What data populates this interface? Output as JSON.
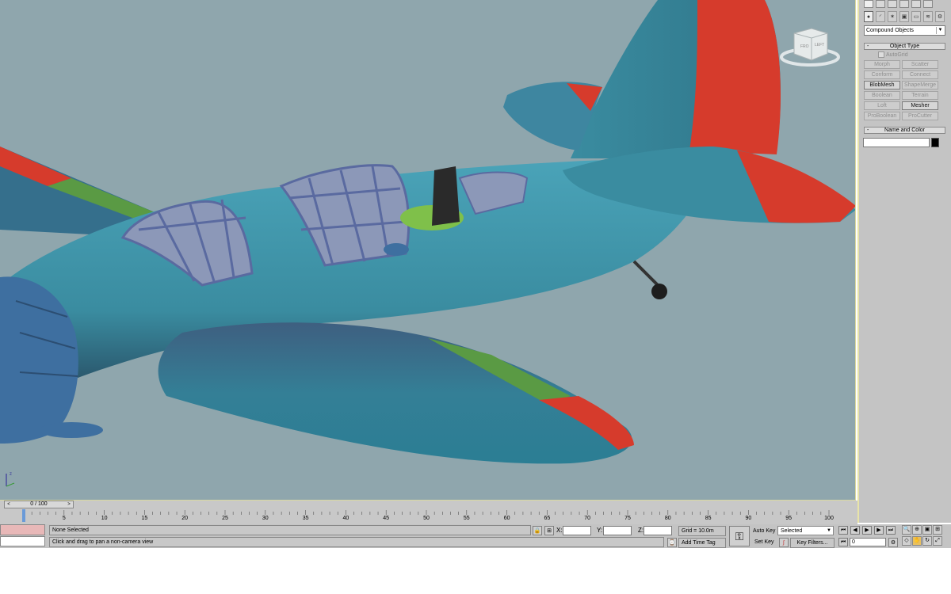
{
  "command_panel": {
    "category_dropdown": "Compound Objects",
    "object_type_rollout": "Object Type",
    "autogrid_label": "AutoGrid",
    "buttons": [
      {
        "label": "Morph",
        "enabled": false
      },
      {
        "label": "Scatter",
        "enabled": false
      },
      {
        "label": "Conform",
        "enabled": false
      },
      {
        "label": "Connect",
        "enabled": false
      },
      {
        "label": "BlobMesh",
        "enabled": true
      },
      {
        "label": "ShapeMerge",
        "enabled": false
      },
      {
        "label": "Boolean",
        "enabled": false
      },
      {
        "label": "Terrain",
        "enabled": false
      },
      {
        "label": "Loft",
        "enabled": false
      },
      {
        "label": "Mesher",
        "enabled": true
      },
      {
        "label": "ProBoolean",
        "enabled": false
      },
      {
        "label": "ProCutter",
        "enabled": false
      }
    ],
    "name_color_rollout": "Name and Color",
    "object_color": "#000000"
  },
  "viewcube": {
    "label_left": "LEFT",
    "label_front": "FRO"
  },
  "viewport": {
    "background": "#8fa6ad",
    "aircraft_color": "#3f8fa3",
    "accent_red": "#d63b2c",
    "accent_green": "#5a9a44"
  },
  "timeline": {
    "slider_text": "0 / 100",
    "prev": "<",
    "next": ">",
    "ticks": [
      0,
      5,
      10,
      15,
      20,
      25,
      30,
      35,
      40,
      45,
      50,
      55,
      60,
      65,
      70,
      75,
      80,
      85,
      90,
      95,
      100
    ]
  },
  "status": {
    "selection_text": "None Selected",
    "prompt_text": "Click and drag to pan a non-camera view",
    "x_label": "X:",
    "y_label": "Y:",
    "z_label": "Z:",
    "grid_text": "Grid = 10.0m",
    "add_time_tag": "Add Time Tag",
    "auto_key": "Auto Key",
    "set_key": "Set Key",
    "key_mode_select": "Selected",
    "key_filters": "Key Filters...",
    "frame_value": "0"
  }
}
